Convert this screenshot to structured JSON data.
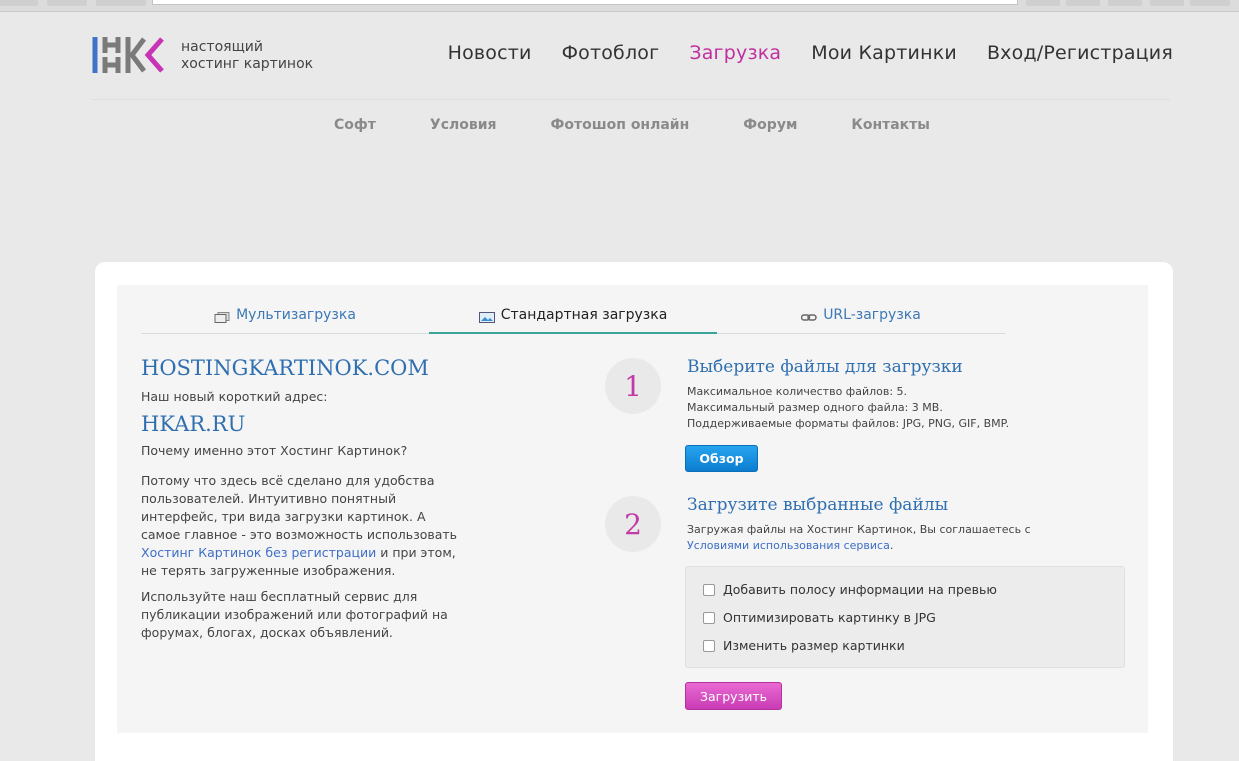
{
  "header": {
    "logo_line1": "настоящий",
    "logo_line2": "хостинг картинок",
    "nav": [
      {
        "label": "Новости"
      },
      {
        "label": "Фотоблог"
      },
      {
        "label": "Загрузка"
      },
      {
        "label": "Мои Картинки"
      },
      {
        "label": "Вход/Регистрация"
      }
    ],
    "active_color": "#c02f9f",
    "subnav": [
      {
        "label": "Софт"
      },
      {
        "label": "Условия"
      },
      {
        "label": "Фотошоп онлайн"
      },
      {
        "label": "Форум"
      },
      {
        "label": "Контакты"
      }
    ]
  },
  "tabs": [
    {
      "label": "Мультизагрузка",
      "icon": "multi-upload-icon"
    },
    {
      "label": "Стандартная загрузка",
      "icon": "image-icon"
    },
    {
      "label": "URL-загрузка",
      "icon": "link-icon"
    }
  ],
  "left": {
    "site_name": "HOSTINGKARTINOK.COM",
    "new_address_label": "Наш новый короткий адрес:",
    "short_domain": "HKAR.RU",
    "why_question": "Почему именно этот Хостинг Картинок?",
    "para1_before": "Потому что здесь всё сделано для удобства пользователей. Интуитивно понятный интерфейс, три вида загрузки картинок. А самое главное - это возможность использовать ",
    "para1_link": "Хостинг Картинок без регистрации",
    "para1_after": " и при этом, не терять загруженные изображения.",
    "para2": "Используйте наш бесплатный сервис для публикации изображений или фотографий на форумах, блогах, досках объявлений."
  },
  "step1": {
    "number": "1",
    "title": "Выберите файлы для загрузки",
    "max_files": "Максимальное количество файлов: 5.",
    "max_size": "Максимальный размер одного файла: 3 MB.",
    "formats": "Поддерживаемые форматы файлов: JPG, PNG, GIF, BMP.",
    "browse_button": "Обзор"
  },
  "step2": {
    "number": "2",
    "title": "Загрузите выбранные файлы",
    "agree_text": "Загружая файлы на Хостинг Картинок, Вы соглашаетесь с",
    "agree_link": "Условиями использования сервиса",
    "agree_end": "."
  },
  "options": [
    {
      "label": "Добавить полосу информации на превью",
      "checked": false
    },
    {
      "label": "Оптимизировать картинку в JPG",
      "checked": false
    },
    {
      "label": "Изменить размер картинки",
      "checked": false
    }
  ],
  "upload_button": "Загрузить"
}
